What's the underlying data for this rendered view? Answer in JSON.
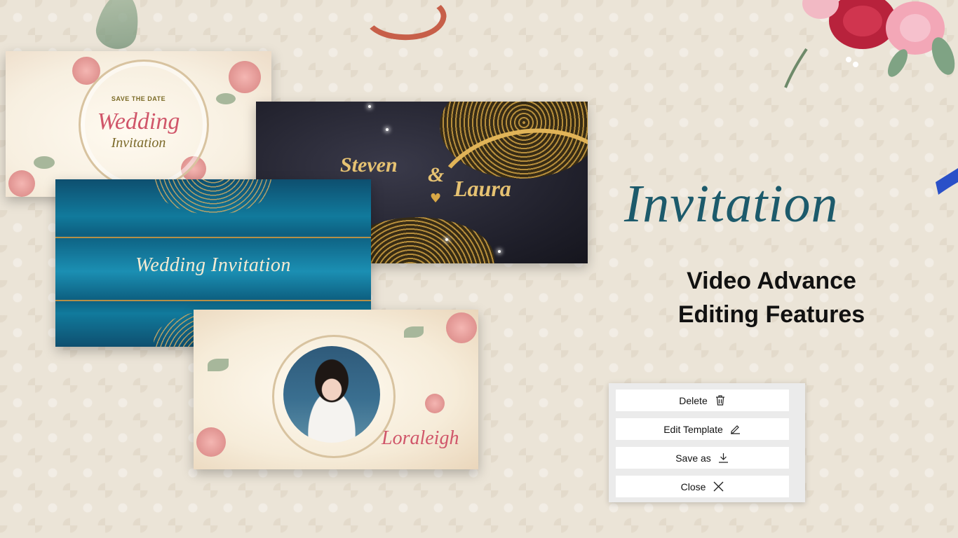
{
  "cards": {
    "save_the_date": {
      "subtitle": "SAVE THE DATE",
      "title": "Wedding",
      "title2": "Invitation"
    },
    "dark": {
      "name1": "Steven",
      "ampersand": "&",
      "name2": "Laura"
    },
    "blue": {
      "title": "Wedding Invitation"
    },
    "photo": {
      "name": "Loraleigh"
    }
  },
  "headline": "Invitation",
  "subheadline": {
    "line1": "Video Advance",
    "line2": "Editing Features"
  },
  "menu": {
    "items": [
      {
        "label": "Delete",
        "icon": "trash-icon"
      },
      {
        "label": "Edit Template",
        "icon": "pencil-icon"
      },
      {
        "label": "Save as",
        "icon": "download-icon"
      },
      {
        "label": "Close",
        "icon": "close-icon"
      }
    ]
  },
  "colors": {
    "background": "#ebe4d7",
    "headline": "#1c5a6b",
    "accent_pink": "#d0566a",
    "gold": "#e6c272"
  }
}
